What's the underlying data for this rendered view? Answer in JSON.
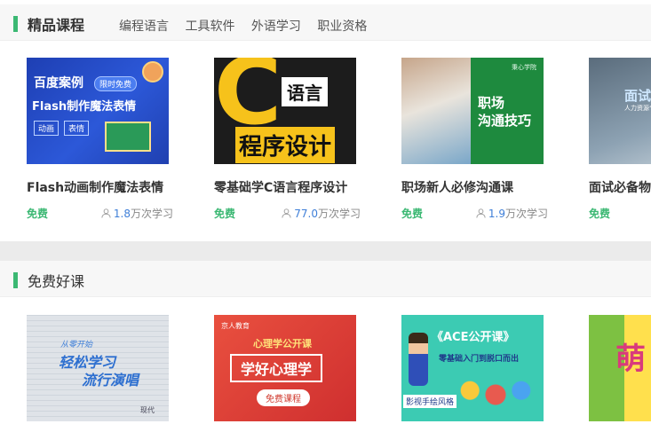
{
  "section1": {
    "title": "精品课程",
    "tabs": [
      "编程语言",
      "工具软件",
      "外语学习",
      "职业资格"
    ],
    "courses": [
      {
        "title": "Flash动画制作魔法表情",
        "price": "免费",
        "count": "1.8",
        "count_unit": "万次学习",
        "thumb": {
          "line1": "百度案例",
          "badge": "限时免费",
          "line2": "Flash制作魔法表情",
          "tag1": "动画",
          "tag2": "表情"
        }
      },
      {
        "title": "零基础学C语言程序设计",
        "price": "免费",
        "count": "77.0",
        "count_unit": "万次学习",
        "thumb": {
          "letter": "C",
          "word1": "语言",
          "word2": "程序设计"
        }
      },
      {
        "title": "职场新人必修沟通课",
        "price": "免费",
        "count": "1.9",
        "count_unit": "万次学习",
        "thumb": {
          "brand": "秉心学院",
          "line1": "职场",
          "line2": "沟通技巧"
        }
      },
      {
        "title": "面试必备物",
        "price": "免费",
        "count": "",
        "count_unit": "",
        "thumb": {
          "line1": "面试",
          "line2": "人力资源专家为您"
        }
      }
    ]
  },
  "section2": {
    "title": "免费好课",
    "courses": [
      {
        "thumb": {
          "line0": "从零开始",
          "line1": "轻松学习",
          "line2": "流行演唱",
          "footer": "现代"
        }
      },
      {
        "thumb": {
          "brand": "京人教育",
          "line1": "心理学公开课",
          "line2": "学好心理学",
          "btn": "免费课程"
        }
      },
      {
        "thumb": {
          "line1": "《ACE公开课》",
          "line2": "零基础入门到脱口而出",
          "line3": "影视手绘风格"
        }
      },
      {
        "thumb": {
          "big": "萌"
        }
      }
    ]
  }
}
